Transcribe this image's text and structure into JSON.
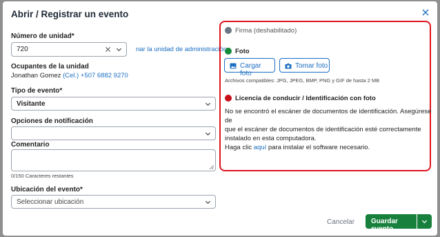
{
  "dialog": {
    "title": "Abrir / Registrar un evento"
  },
  "unit": {
    "label": "Número de unidad*",
    "value": "720",
    "admin_link": "nar la unidad de administración"
  },
  "occupants": {
    "label": "Ocupantes de la unidad",
    "name": "Jonathan Gomez",
    "phone": "(Cel.) +507 6882 9270"
  },
  "event_type": {
    "label": "Tipo de evento*",
    "value": "Visitante"
  },
  "notification": {
    "label": "Opciones de notificación",
    "value": ""
  },
  "comment": {
    "label": "Comentario",
    "value": "",
    "counter": "0/150 Caracteres restantes"
  },
  "location": {
    "label": "Ubicación del evento*",
    "placeholder": "Seleccionar ubicación"
  },
  "signature": {
    "label": "Firma (deshabilitado)",
    "color": "#6b7785"
  },
  "photo": {
    "label": "Foto",
    "color": "#138a3a",
    "upload_label": "Cargar foto",
    "take_label": "Tomar foto",
    "formats": "Archivos compatibles: JPG, JPEG, BMP, PNG y GIF de hasta 2 MB"
  },
  "license": {
    "label": "Licencia de conducir / Identificación con foto",
    "color": "#c8101a",
    "message_line1": "No se encontró el escáner de documentos de identificación. Asegúrese de",
    "message_line2": "que el escáner de documentos de identificación esté correctamente",
    "message_line3": "instalado en esta computadora.",
    "install_prefix": "Haga clic",
    "install_link": "aquí",
    "install_suffix": "para instalar el software necesario."
  },
  "footer": {
    "cancel_label": "Cancelar",
    "save_label": "Guardar evento"
  },
  "colors": {
    "accent": "#1b6ec2",
    "primary_button": "#16803c",
    "highlight_border": "#e0101a"
  }
}
